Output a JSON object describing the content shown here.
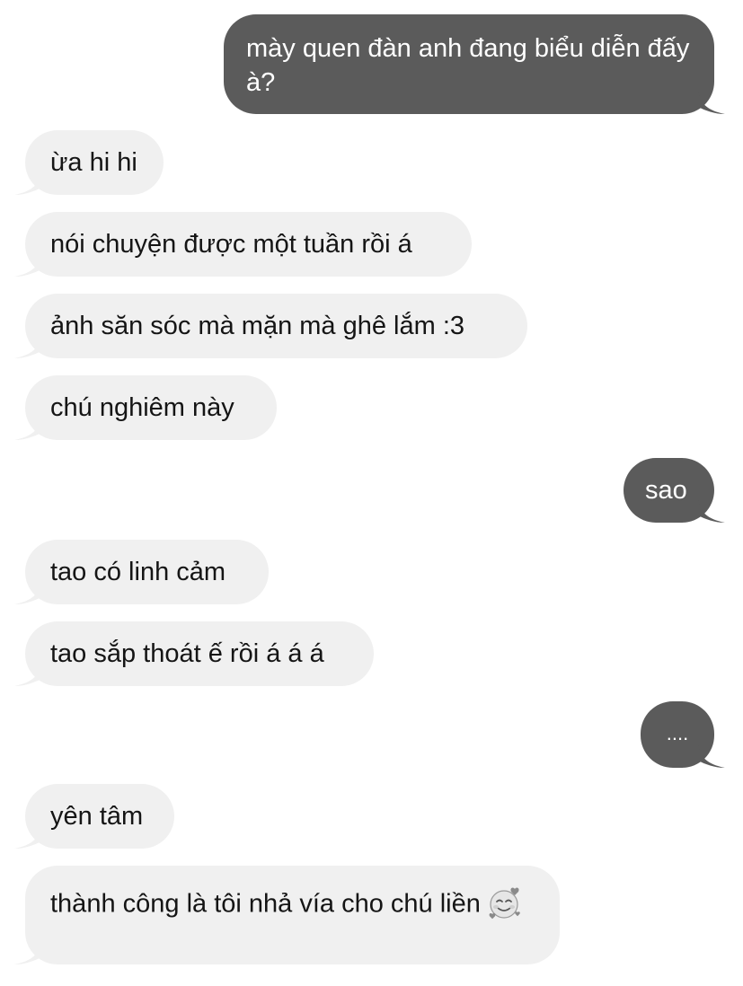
{
  "colors": {
    "sent_bubble": "#5b5b5b",
    "received_bubble": "#f0f0f0",
    "background": "#ffffff"
  },
  "messages": [
    {
      "direction": "sent",
      "text": "mày quen đàn anh đang biểu diễn đấy à?"
    },
    {
      "direction": "received",
      "text": "ừa hi hi"
    },
    {
      "direction": "received",
      "text": "nói chuyện được một tuần rồi á"
    },
    {
      "direction": "received",
      "text": "ảnh săn sóc mà mặn mà ghê lắm :3"
    },
    {
      "direction": "received",
      "text": "chú nghiêm này"
    },
    {
      "direction": "sent",
      "text": "sao"
    },
    {
      "direction": "received",
      "text": "tao có linh cảm"
    },
    {
      "direction": "received",
      "text": "tao sắp thoát ế rồi á á á"
    },
    {
      "direction": "sent",
      "text": "...."
    },
    {
      "direction": "received",
      "text": "yên tâm"
    },
    {
      "direction": "received",
      "text": "thành công là tôi nhả vía cho chú liền",
      "emoji": "smiling-face-with-hearts"
    }
  ]
}
